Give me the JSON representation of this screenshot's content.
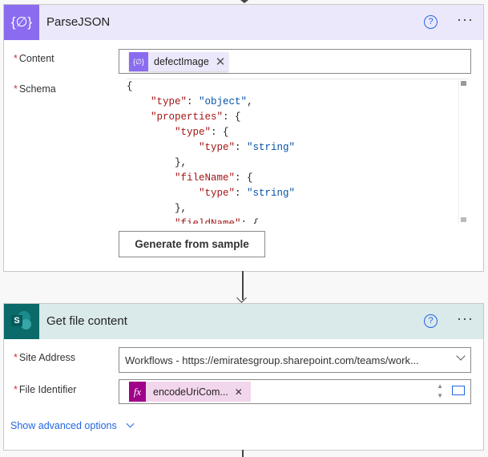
{
  "parse_json": {
    "title": "ParseJSON",
    "content_label": "Content",
    "content_token": "defectImage",
    "schema_label": "Schema",
    "schema_lines": [
      [
        {
          "t": "{",
          "c": ""
        }
      ],
      [
        {
          "t": "    ",
          "c": ""
        },
        {
          "t": "\"type\"",
          "c": "k"
        },
        {
          "t": ": ",
          "c": ""
        },
        {
          "t": "\"object\"",
          "c": "s"
        },
        {
          "t": ",",
          "c": ""
        }
      ],
      [
        {
          "t": "    ",
          "c": ""
        },
        {
          "t": "\"properties\"",
          "c": "k"
        },
        {
          "t": ": {",
          "c": ""
        }
      ],
      [
        {
          "t": "        ",
          "c": ""
        },
        {
          "t": "\"type\"",
          "c": "k"
        },
        {
          "t": ": {",
          "c": ""
        }
      ],
      [
        {
          "t": "            ",
          "c": ""
        },
        {
          "t": "\"type\"",
          "c": "k"
        },
        {
          "t": ": ",
          "c": ""
        },
        {
          "t": "\"string\"",
          "c": "s"
        }
      ],
      [
        {
          "t": "        },",
          "c": ""
        }
      ],
      [
        {
          "t": "        ",
          "c": ""
        },
        {
          "t": "\"fileName\"",
          "c": "k"
        },
        {
          "t": ": {",
          "c": ""
        }
      ],
      [
        {
          "t": "            ",
          "c": ""
        },
        {
          "t": "\"type\"",
          "c": "k"
        },
        {
          "t": ": ",
          "c": ""
        },
        {
          "t": "\"string\"",
          "c": "s"
        }
      ],
      [
        {
          "t": "        },",
          "c": ""
        }
      ],
      [
        {
          "t": "        ",
          "c": ""
        },
        {
          "t": "\"fieldName\"",
          "c": "k"
        },
        {
          "t": ": {",
          "c": ""
        }
      ]
    ],
    "generate_button": "Generate from sample",
    "accent": "#8b6cf0"
  },
  "get_file": {
    "title": "Get file content",
    "site_label": "Site Address",
    "site_value": "Workflows - https://emiratesgroup.sharepoint.com/teams/work...",
    "file_label": "File Identifier",
    "file_token": "encodeUriCom...",
    "advanced": "Show advanced options",
    "accent": "#0b6a6a"
  },
  "help_glyph": "?",
  "more_glyph": "···"
}
